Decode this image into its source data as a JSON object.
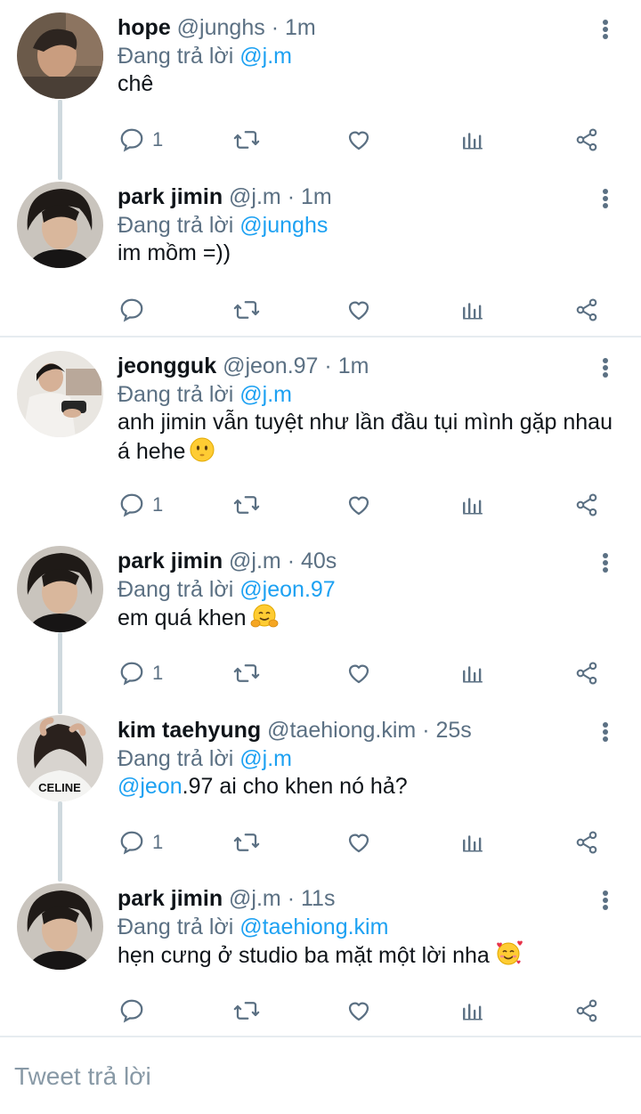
{
  "colors": {
    "accent": "#1da1f2",
    "muted": "#5b7083",
    "line": "#cfd9de"
  },
  "tweets": [
    {
      "name": "hope",
      "handle": "@junghs",
      "sep": "·",
      "time": "1m",
      "reply_prefix": "Đang trả lời",
      "reply_to": "@j.m",
      "text_mention": "",
      "text": "chê",
      "reply_count": "1",
      "emoji": ""
    },
    {
      "name": "park jimin",
      "handle": "@j.m",
      "sep": "·",
      "time": "1m",
      "reply_prefix": "Đang trả lời",
      "reply_to": "@junghs",
      "text_mention": "",
      "text": "im mồm =))",
      "reply_count": "",
      "emoji": ""
    },
    {
      "name": "jeongguk",
      "handle": "@jeon.97",
      "sep": "·",
      "time": "1m",
      "reply_prefix": "Đang trả lời",
      "reply_to": "@j.m",
      "text_mention": "",
      "text": "anh jimin vẫn tuyệt như lần đầu tụi mình gặp nhau á hehe",
      "reply_count": "1",
      "emoji": "smiling-face-icon"
    },
    {
      "name": "park jimin",
      "handle": "@j.m",
      "sep": "·",
      "time": "40s",
      "reply_prefix": "Đang trả lời",
      "reply_to": "@jeon.97",
      "text_mention": "",
      "text": "em quá khen",
      "reply_count": "1",
      "emoji": "hugging-face-icon"
    },
    {
      "name": "kim taehyung",
      "handle": "@taehiong.kim",
      "sep": "·",
      "time": "25s",
      "reply_prefix": "Đang trả lời",
      "reply_to": "@j.m",
      "text_mention": "@jeon",
      "text": ".97 ai cho khen nó hả?",
      "reply_count": "1",
      "emoji": ""
    },
    {
      "name": "park jimin",
      "handle": "@j.m",
      "sep": "·",
      "time": "11s",
      "reply_prefix": "Đang trả lời",
      "reply_to": "@taehiong.kim",
      "text_mention": "",
      "text": "hẹn cưng ở studio ba mặt một lời nha",
      "reply_count": "",
      "emoji": "smiling-face-with-hearts-icon"
    }
  ],
  "reply_bar": {
    "placeholder": "Tweet trả lời"
  }
}
